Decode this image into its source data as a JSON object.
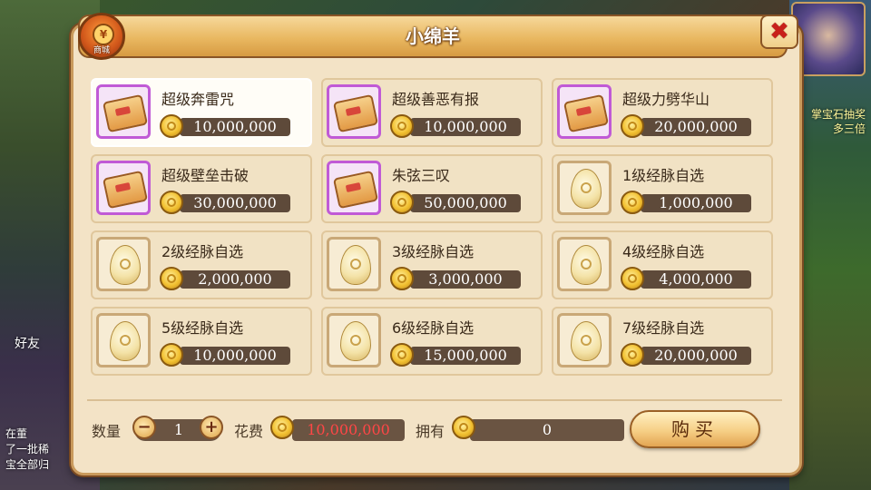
{
  "title": "小绵羊",
  "shop_badge": {
    "label": "商城"
  },
  "close_label": "✖",
  "background": {
    "friend_label": "好友",
    "chat_lines": [
      "在董",
      "了一批稀",
      "宝全部归"
    ],
    "right_lines": [
      "掌宝石抽奖",
      "多三倍"
    ]
  },
  "items": [
    {
      "name": "超级奔雷咒",
      "price": "10,000,000",
      "icon": "scroll",
      "frame": "purple",
      "selected": true
    },
    {
      "name": "超级善恶有报",
      "price": "10,000,000",
      "icon": "scroll",
      "frame": "purple"
    },
    {
      "name": "超级力劈华山",
      "price": "20,000,000",
      "icon": "scroll",
      "frame": "purple"
    },
    {
      "name": "超级壁垒击破",
      "price": "30,000,000",
      "icon": "scroll",
      "frame": "purple"
    },
    {
      "name": "朱弦三叹",
      "price": "50,000,000",
      "icon": "scroll",
      "frame": "purple"
    },
    {
      "name": "1级经脉自选",
      "price": "1,000,000",
      "icon": "egg",
      "frame": "tan"
    },
    {
      "name": "2级经脉自选",
      "price": "2,000,000",
      "icon": "egg",
      "frame": "tan"
    },
    {
      "name": "3级经脉自选",
      "price": "3,000,000",
      "icon": "egg",
      "frame": "tan"
    },
    {
      "name": "4级经脉自选",
      "price": "4,000,000",
      "icon": "egg",
      "frame": "tan"
    },
    {
      "name": "5级经脉自选",
      "price": "10,000,000",
      "icon": "egg",
      "frame": "tan"
    },
    {
      "name": "6级经脉自选",
      "price": "15,000,000",
      "icon": "egg",
      "frame": "tan"
    },
    {
      "name": "7级经脉自选",
      "price": "20,000,000",
      "icon": "egg",
      "frame": "tan"
    }
  ],
  "footer": {
    "qty_label": "数量",
    "qty_minus": "−",
    "qty_value": "1",
    "qty_plus": "+",
    "cost_label": "花费",
    "cost_value": "10,000,000",
    "own_label": "拥有",
    "own_value": "0",
    "buy_label": "购买"
  }
}
